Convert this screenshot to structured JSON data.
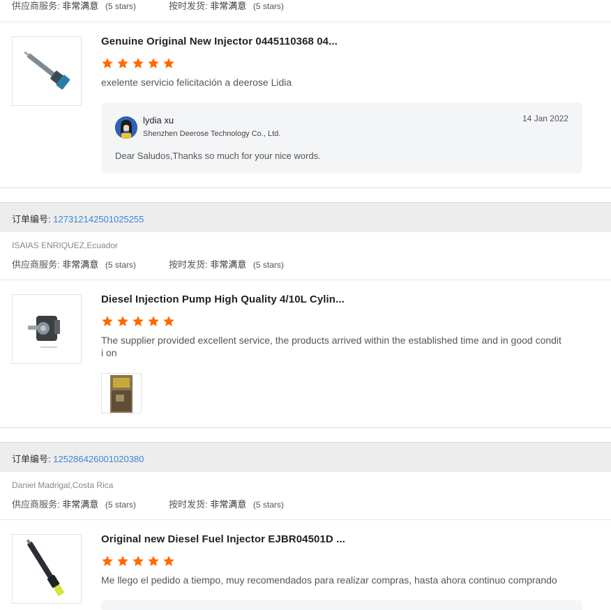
{
  "labels": {
    "supplier_service": "供应商服务:",
    "ontime_delivery": "按时发货:",
    "very_satisfied": "非常满意",
    "five_stars": "(5 stars)",
    "order_number": "订单编号:"
  },
  "colors": {
    "star": "#ff6a00",
    "link": "#3a87d6",
    "order_bar": "#ededed"
  },
  "top_rating": {
    "service_value": "非常满意",
    "delivery_value": "非常满意"
  },
  "reviews": [
    {
      "product_title": "Genuine Original New Injector 0445110368 04...",
      "rating": 5,
      "comment": "exelente servicio felicitación a deerose Lidia",
      "reply": {
        "name": "lydia xu",
        "company": "Shenzhen Deerose Technology Co., Ltd.",
        "date": "14 Jan 2022",
        "text": "Dear Saludos,Thanks so much for your nice words."
      }
    },
    {
      "order_number": "127312142501025255",
      "buyer": "ISAIAS ENRIQUEZ,Ecuador",
      "product_title": "Diesel Injection Pump High Quality 4/10L Cylin...",
      "rating": 5,
      "comment": "The supplier provided excellent service, the products arrived within the established time and in good conditi on"
    },
    {
      "order_number": "125286426001020380",
      "buyer": "Daniel Madrigal,Costa Rica",
      "product_title": "Original new Diesel Fuel Injector EJBR04501D ...",
      "rating": 5,
      "comment": "Me llego el pedido a tiempo, muy recomendados para realizar compras, hasta ahora continuo comprando"
    }
  ]
}
